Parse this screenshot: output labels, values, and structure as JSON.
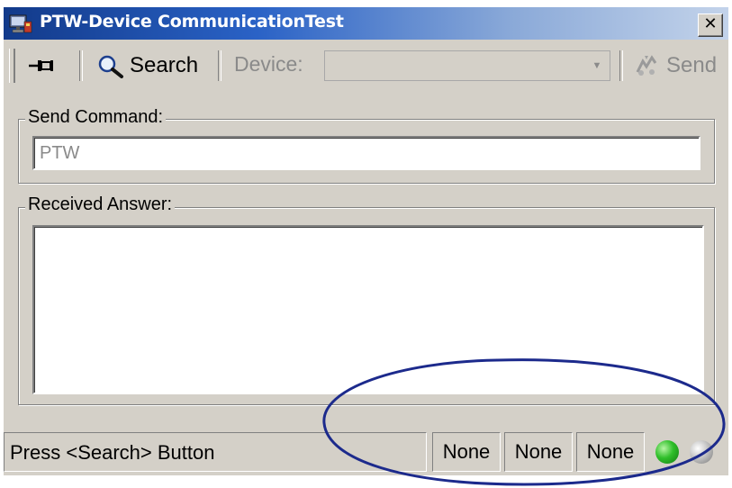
{
  "window": {
    "title": "PTW-Device CommunicationTest",
    "close_label": "✕"
  },
  "toolbar": {
    "pin_icon": "pin-icon",
    "search_label": "Search",
    "search_icon": "magnifier-icon",
    "device_label": "Device:",
    "device_value": "",
    "send_label": "Send",
    "send_icon": "send-icon"
  },
  "send_command": {
    "label": "Send Command:",
    "value": "PTW"
  },
  "received_answer": {
    "label": "Received Answer:",
    "value": ""
  },
  "statusbar": {
    "message": "Press <Search> Button",
    "panels": [
      "None",
      "None",
      "None"
    ],
    "indicators": [
      {
        "name": "status-led-green",
        "color": "#2fbf2a"
      },
      {
        "name": "status-led-gray",
        "color": "#b8b8b8"
      }
    ]
  },
  "annotation": {
    "color": "#1c2a8c",
    "shape": "ellipse"
  }
}
